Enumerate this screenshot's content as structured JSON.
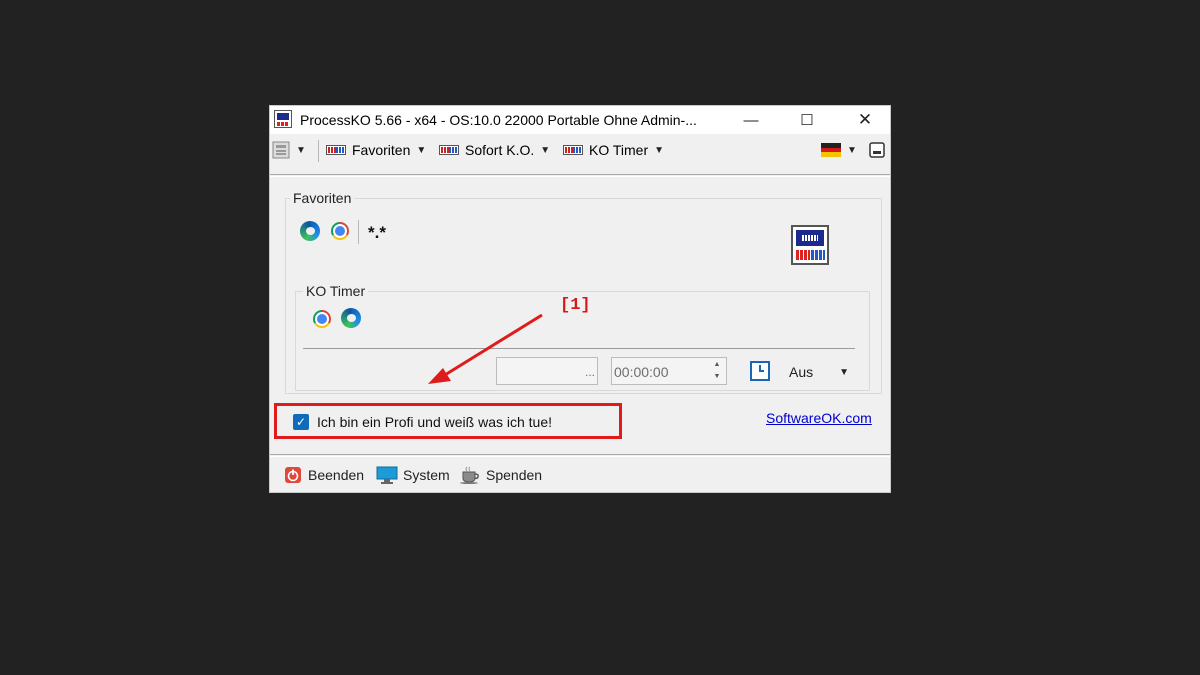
{
  "window": {
    "title": "ProcessKO 5.66 - x64  - OS:10.0 22000 Portable Ohne Admin-...",
    "minimize_glyph": "—",
    "maximize_glyph": "☐",
    "close_glyph": "✕"
  },
  "menu": {
    "items": [
      {
        "label": "Favoriten",
        "icon": "ko-icon"
      },
      {
        "label": "Sofort K.O.",
        "icon": "ko-icon"
      },
      {
        "label": "KO Timer",
        "icon": "ko-icon"
      }
    ],
    "dropdown_glyph": "▼"
  },
  "favorites": {
    "label": "Favoriten",
    "wildcard": "*.*",
    "icons": [
      "edge-icon",
      "chrome-icon"
    ]
  },
  "ko_timer": {
    "label": "KO Timer",
    "icons": [
      "chrome-icon",
      "edge-icon"
    ],
    "process_field_value": "...",
    "time_value": "00:00:00",
    "spin_up": "▲",
    "spin_down": "▼",
    "mode_value": "Aus"
  },
  "checkbox": {
    "label": "Ich bin ein Profi und weiß was ich tue!",
    "checked": true,
    "check_glyph": "✓"
  },
  "link": "SoftwareOK.com",
  "bottom": {
    "items": [
      {
        "label": "Beenden",
        "icon": "power-icon"
      },
      {
        "label": "System",
        "icon": "monitor-icon"
      },
      {
        "label": "Spenden",
        "icon": "coffee-icon"
      }
    ]
  },
  "annotation": {
    "label": "[1]",
    "color": "#e01b1b"
  },
  "colors": {
    "background": "#222222",
    "window": "#f0f0f0",
    "accent": "#0f6cbd",
    "link": "#0000cc"
  }
}
